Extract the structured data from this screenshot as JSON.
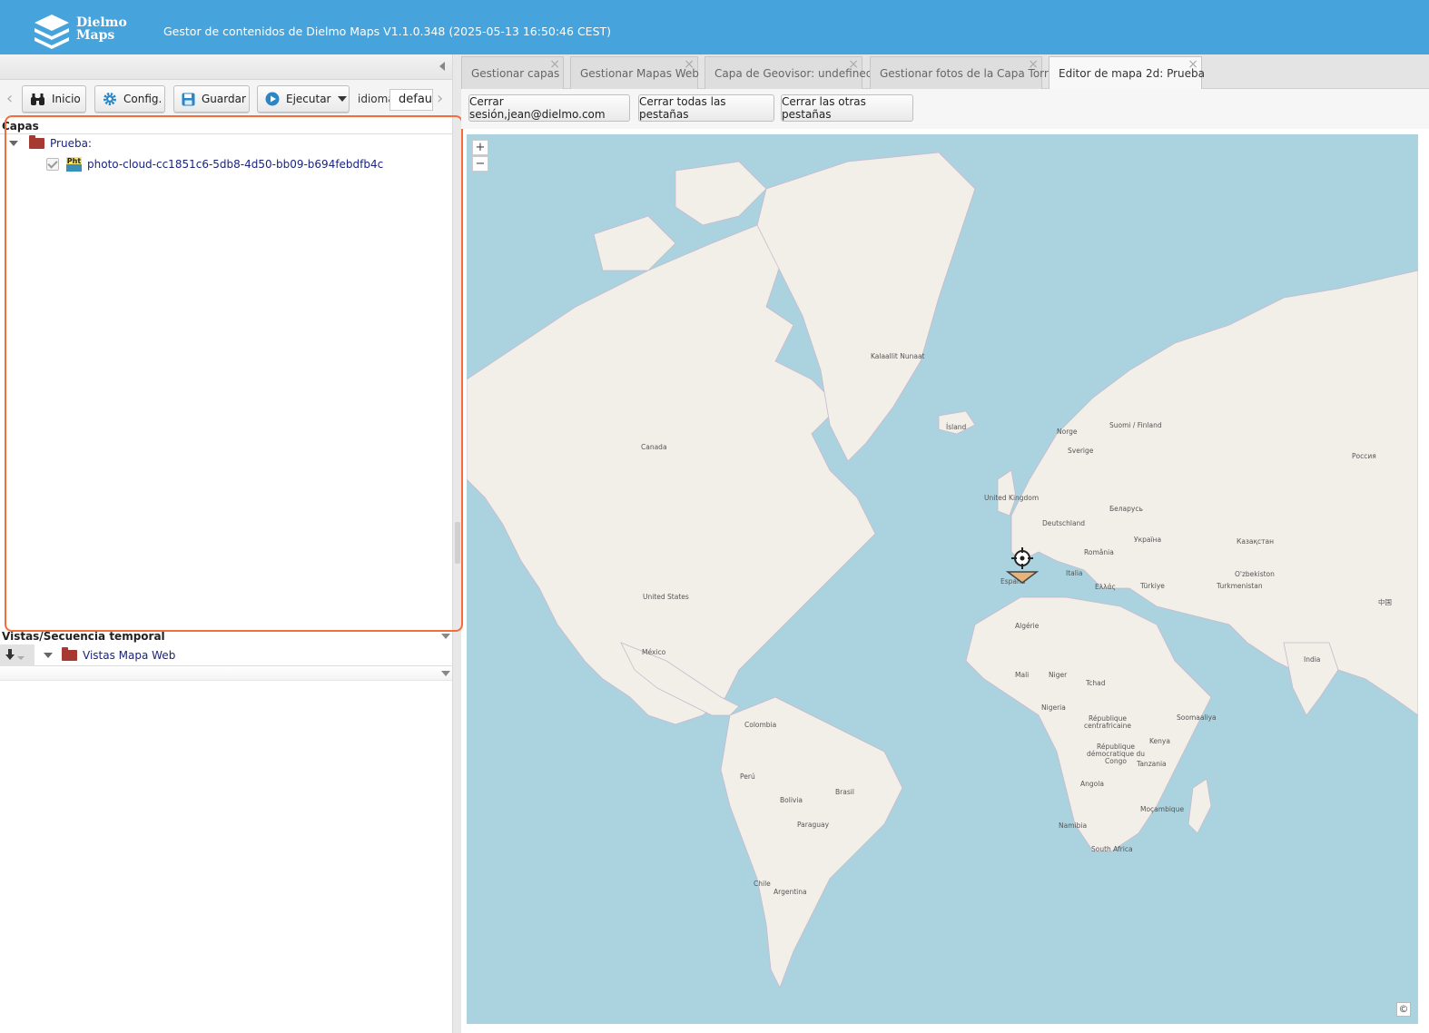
{
  "header": {
    "logo_line1": "Dielmo",
    "logo_line2": "Maps",
    "title": "Gestor de contenidos de Dielmo Maps V1.1.0.348 (2025-05-13 16:50:46 CEST)"
  },
  "toolbar": {
    "inicio": "Inicio",
    "config": "Config.",
    "guardar": "Guardar",
    "ejecutar": "Ejecutar",
    "idioma_label": "idioma:",
    "idioma_value": "default"
  },
  "layers": {
    "header": "Capas",
    "folder": "Prueba:",
    "item_icon_text": "Pht",
    "item": "photo-cloud-cc1851c6-5db8-4d50-bb09-b694febdfb4c"
  },
  "views": {
    "header": "Vistas/Secuencia temporal",
    "folder": "Vistas Mapa Web"
  },
  "tabs": [
    {
      "label": "Gestionar capas",
      "active": false
    },
    {
      "label": "Gestionar Mapas Web",
      "active": false
    },
    {
      "label": "Capa de Geovisor: undefined",
      "active": false
    },
    {
      "label": "Gestionar fotos de la Capa Torre",
      "active": false
    },
    {
      "label": "Editor de mapa 2d: Prueba",
      "active": true
    }
  ],
  "actions": {
    "logout": "Cerrar sesión,jean@dielmo.com",
    "close_all": "Cerrar todas las pestañas",
    "close_others": "Cerrar las otras pestañas"
  },
  "map": {
    "zoom_in": "+",
    "zoom_out": "−",
    "copyright": "©",
    "labels": [
      "Kalaallit Nunaat",
      "Canada",
      "United States",
      "México",
      "Ísland",
      "Norge",
      "Sverige",
      "Suomi / Finland",
      "United Kingdom",
      "Deutschland",
      "Беларусь",
      "Україна",
      "România",
      "España",
      "Italia",
      "Ελλάς",
      "Türkiye",
      "Россия",
      "Казақстан",
      "O'zbekiston",
      "Turkmenistan",
      "Algérie",
      "Mali",
      "Niger",
      "Tchad",
      "Nigeria",
      "Colombia",
      "Perú",
      "Brasil",
      "Bolivia",
      "Paraguay",
      "Chile",
      "Argentina",
      "Angola",
      "Namibia",
      "South Africa",
      "Moçambique",
      "Tanzania",
      "Kenya",
      "Soomaaliya",
      "India",
      "République démocratique du Congo",
      "République centrafricaine",
      "中国"
    ],
    "colors": {
      "water": "#aad3df",
      "land": "#f2efe9",
      "border": "#c9b8cc"
    }
  }
}
